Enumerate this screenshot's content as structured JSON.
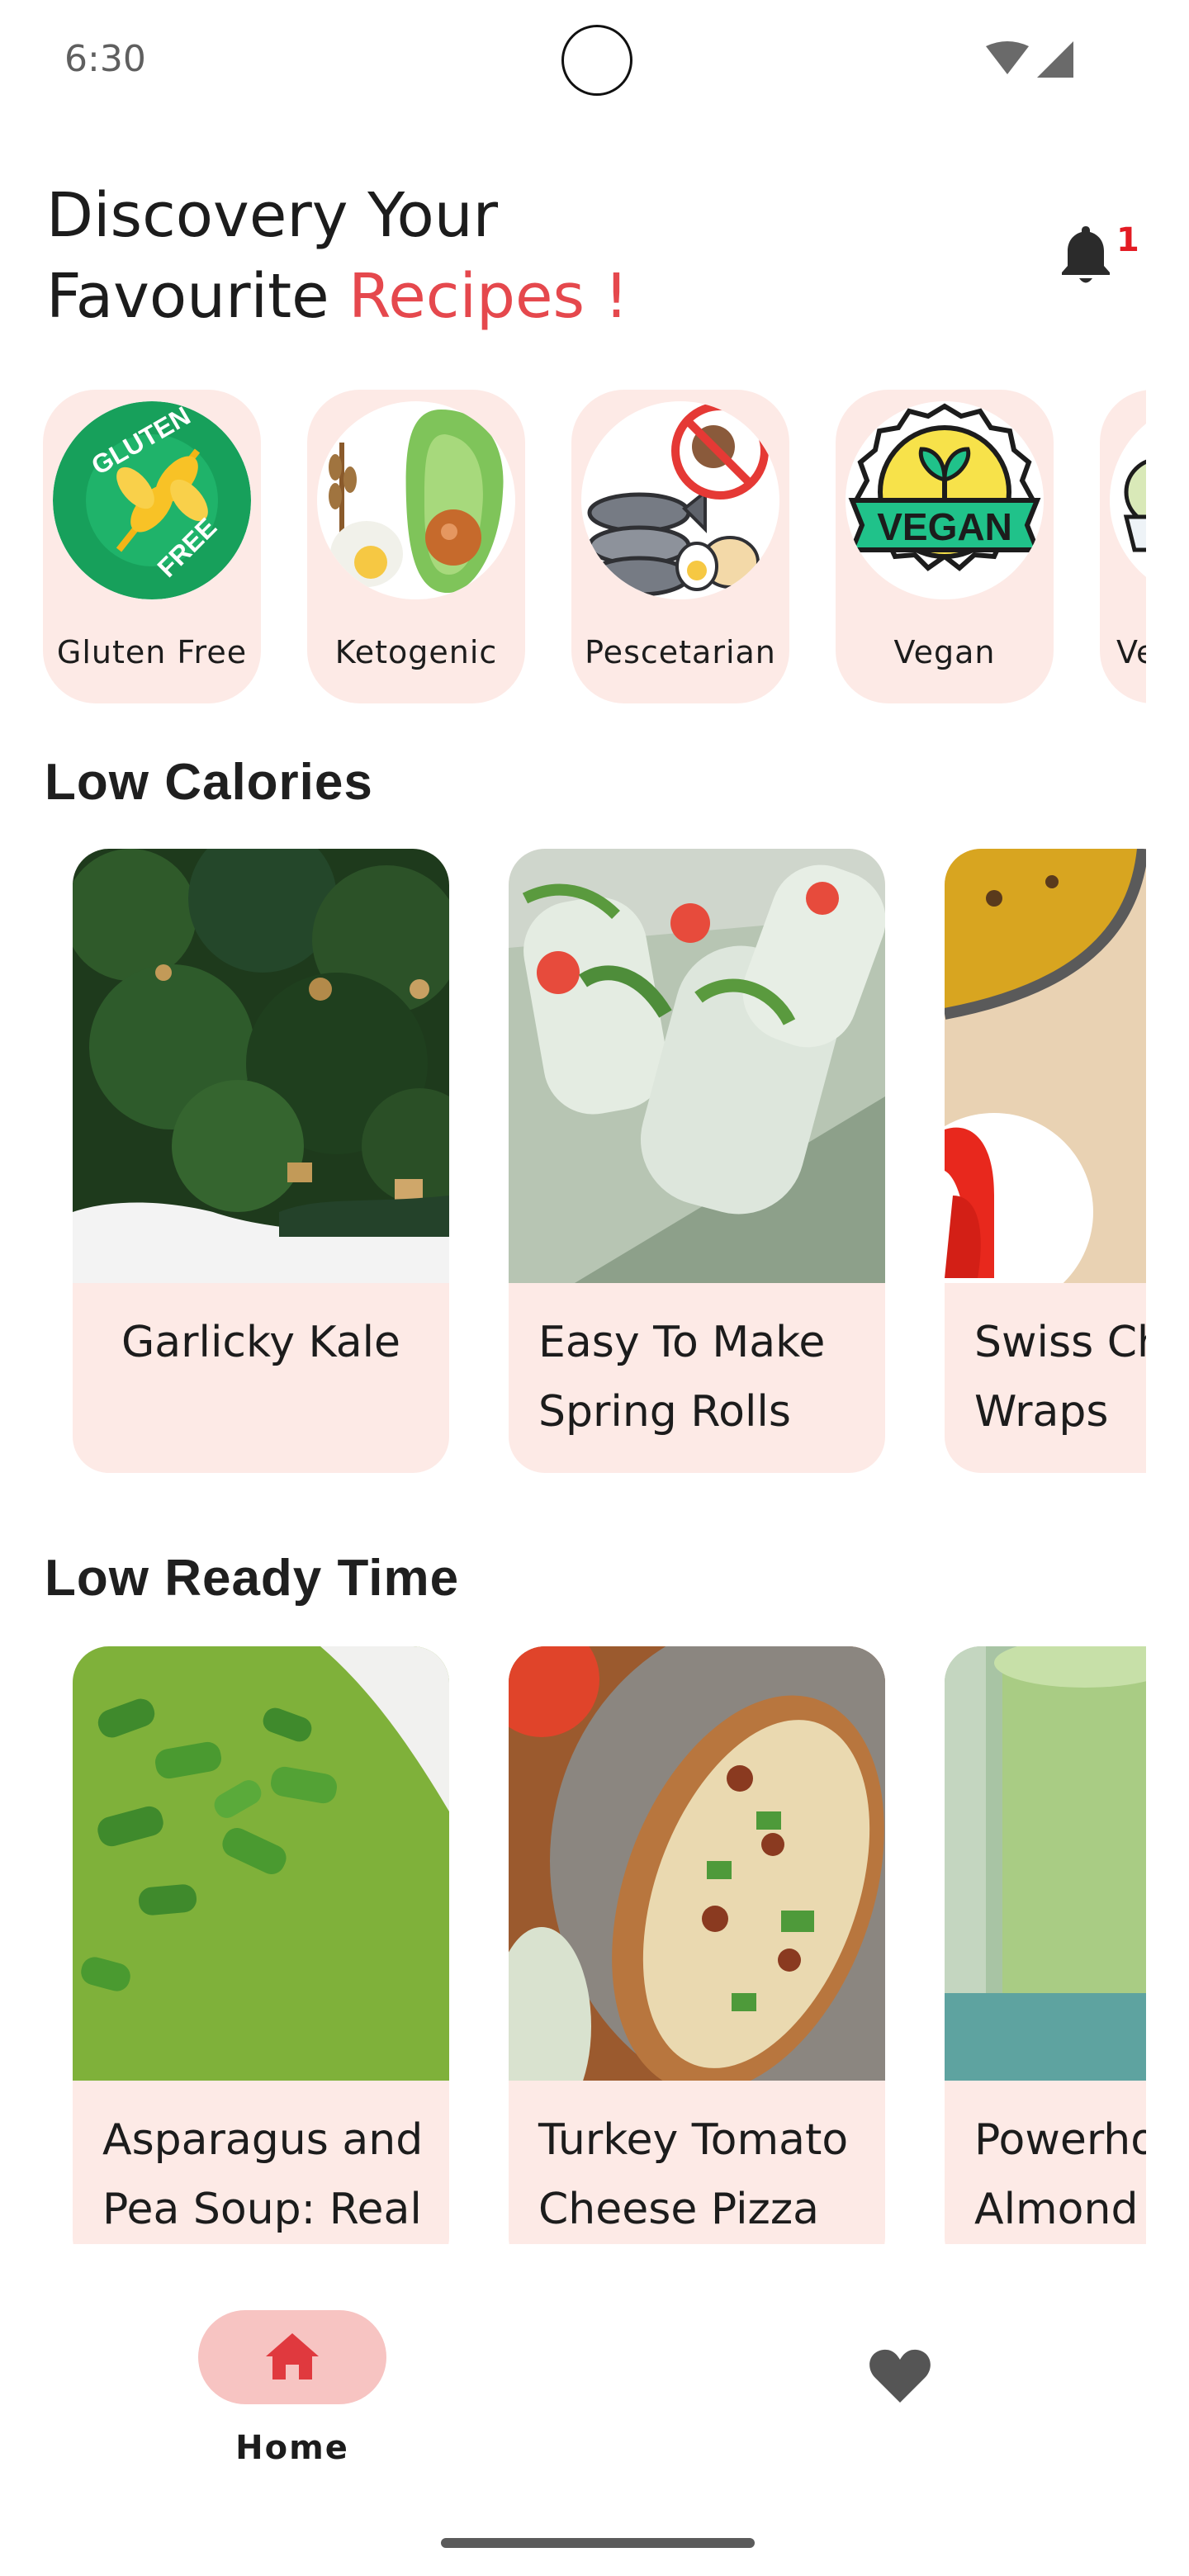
{
  "status_bar": {
    "time": "6:30"
  },
  "header": {
    "title_line1": "Discovery Your",
    "title_line2_prefix": "Favourite ",
    "title_line2_accent": "Recipes !",
    "accent_color": "#e5484d",
    "notification_count": "1"
  },
  "categories": [
    {
      "label": "Gluten Free",
      "icon": "gluten-free-icon"
    },
    {
      "label": "Ketogenic",
      "icon": "ketogenic-icon"
    },
    {
      "label": "Pescetarian",
      "icon": "pescetarian-icon"
    },
    {
      "label": "Vegan",
      "icon": "vegan-icon"
    },
    {
      "label": "Ve",
      "icon": "vegetarian-icon"
    }
  ],
  "low_calories": {
    "title": "Low Calories",
    "recipes": [
      {
        "name": "Garlicky Kale"
      },
      {
        "name": "Easy To Make Spring Rolls"
      },
      {
        "name": "Swiss Ch Wraps"
      }
    ]
  },
  "low_ready_time": {
    "title": "Low Ready Time",
    "recipes": [
      {
        "name": "Asparagus and Pea Soup: Real"
      },
      {
        "name": "Turkey Tomato Cheese Pizza"
      },
      {
        "name": "Powerho Almond I"
      }
    ]
  },
  "bottom_nav": {
    "home_label": "Home",
    "home_icon": "home-icon",
    "favorites_icon": "heart-icon"
  },
  "colors": {
    "card_background": "#fdeae6",
    "nav_active_pill": "#f7c4c2",
    "badge": "#e31b23"
  }
}
